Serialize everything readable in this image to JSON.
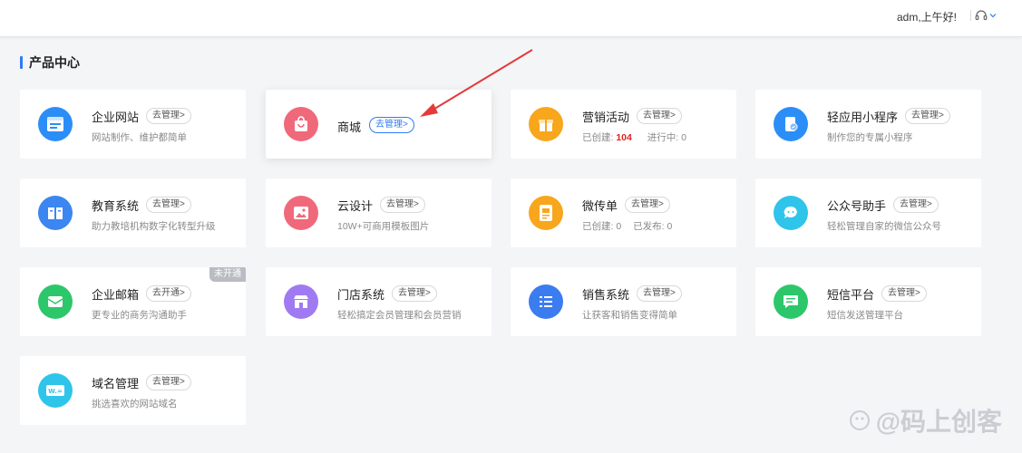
{
  "header": {
    "greeting": "adm,上午好!"
  },
  "section": {
    "title": "产品中心"
  },
  "products": [
    {
      "name": "企业网站",
      "manage": "去管理>",
      "desc": "网站制作、维护都简单"
    },
    {
      "name": "商城",
      "manage": "去管理>",
      "desc": ""
    },
    {
      "name": "营销活动",
      "manage": "去管理>",
      "stats": {
        "created_label": "已创建:",
        "created_value": "104",
        "running_label": "进行中:",
        "running_value": "0"
      }
    },
    {
      "name": "轻应用小程序",
      "manage": "去管理>",
      "desc": "制作您的专属小程序"
    },
    {
      "name": "教育系统",
      "manage": "去管理>",
      "desc": "助力教培机构数字化转型升级"
    },
    {
      "name": "云设计",
      "manage": "去管理>",
      "desc": "10W+可商用模板图片"
    },
    {
      "name": "微传单",
      "manage": "去管理>",
      "stats": {
        "created_label": "已创建:",
        "created_value": "0",
        "published_label": "已发布:",
        "published_value": "0"
      }
    },
    {
      "name": "公众号助手",
      "manage": "去管理>",
      "desc": "轻松管理自家的微信公众号"
    },
    {
      "name": "企业邮箱",
      "manage": "去开通>",
      "desc": "更专业的商务沟通助手",
      "badge": "未开通"
    },
    {
      "name": "门店系统",
      "manage": "去管理>",
      "desc": "轻松搞定会员管理和会员营销"
    },
    {
      "name": "销售系统",
      "manage": "去管理>",
      "desc": "让获客和销售变得简单"
    },
    {
      "name": "短信平台",
      "manage": "去管理>",
      "desc": "短信发送管理平台"
    },
    {
      "name": "域名管理",
      "manage": "去管理>",
      "desc": "挑选喜欢的网站域名"
    }
  ],
  "watermark": "@码上创客",
  "colors": {
    "accent": "#2f7cf6",
    "stat_highlight": "#e02020",
    "icon_blue": "#2b8ef7",
    "icon_pink": "#f0697a",
    "icon_orange": "#f8a61c",
    "icon_cyan": "#2fc4ea",
    "icon_green": "#2cc76a",
    "icon_purple": "#a07af2"
  }
}
